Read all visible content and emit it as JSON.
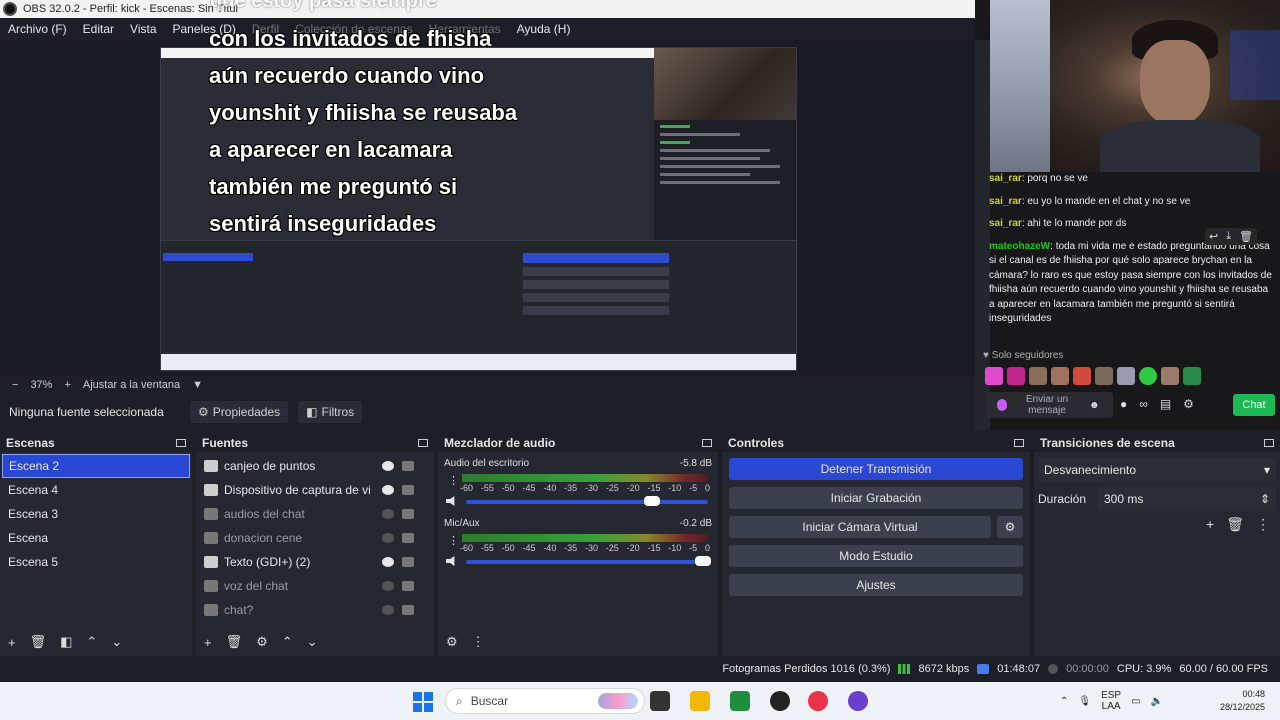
{
  "window": {
    "title": "OBS 32.0.2 - Perfil: kick - Escenas: Sin Títul",
    "overlay_caption_top": "que estoy pasa siempre"
  },
  "menu": [
    "Archivo (F)",
    "Editar",
    "Vista",
    "Paneles (D)",
    "Perfil",
    "Colección de escenas",
    "Herramientas",
    "Ayuda (H)"
  ],
  "preview": {
    "overlay_text": "con los invitados de fhisha aún recuerdo cuando vino younshit y fhiisha se reusaba a aparecer en lacamara también me preguntó si sentirá inseguridades",
    "zoom": "37%",
    "fit_label": "Ajustar a la ventana"
  },
  "sourcebar": {
    "no_source": "Ninguna fuente seleccionada",
    "properties": "Propiedades",
    "filters": "Filtros"
  },
  "chat": {
    "messages": [
      {
        "user": "sai_rar",
        "text": "porq no se ve"
      },
      {
        "user": "sai_rar",
        "text": "eu yo lo mande en el chat y no se ve"
      },
      {
        "user": "sai_rar",
        "text": "ahi te lo mande por ds"
      },
      {
        "user": "mateohazeW",
        "text": "toda mi vida me e estado preguntando una cosa si el canal es de fhiisha por qué solo aparece brychan en la cámara? lo raro es que estoy pasa siempre con los invitados de fhiisha aún recuerdo cuando vino younshit y fhiisha se reusaba a aparecer en lacamara también me preguntó si sentirá inseguridades"
      }
    ],
    "followers_only": "Solo seguidores",
    "input_placeholder": "Enviar un mensaje",
    "chat_button": "Chat"
  },
  "scenes": {
    "title": "Escenas",
    "items": [
      "Escena 2",
      "Escena 4",
      "Escena 3",
      "Escena",
      "Escena 5"
    ],
    "selected": "Escena 2"
  },
  "sources": {
    "title": "Fuentes",
    "items": [
      {
        "label": "canjeo de puntos",
        "visible": true
      },
      {
        "label": "Dispositivo de captura de vi",
        "visible": true
      },
      {
        "label": "audios del chat",
        "visible": false
      },
      {
        "label": "donacion cene",
        "visible": false
      },
      {
        "label": "Texto (GDI+) (2)",
        "visible": true
      },
      {
        "label": "voz del chat",
        "visible": false
      },
      {
        "label": "chat?",
        "visible": false
      }
    ]
  },
  "mixer": {
    "title": "Mezclador de audio",
    "channels": [
      {
        "name": "Audio del escritorio",
        "db": "-5.8 dB",
        "volume": 0.77
      },
      {
        "name": "Mic/Aux",
        "db": "-0.2 dB",
        "volume": 0.98
      }
    ],
    "scale": [
      "-60",
      "-55",
      "-50",
      "-45",
      "-40",
      "-35",
      "-30",
      "-25",
      "-20",
      "-15",
      "-10",
      "-5",
      "0"
    ]
  },
  "controls": {
    "title": "Controles",
    "buttons": [
      "Detener Transmisión",
      "Iniciar Grabación",
      "Iniciar Cámara Virtual",
      "Modo Estudio",
      "Ajustes"
    ]
  },
  "transitions": {
    "title": "Transiciones de escena",
    "selected": "Desvanecimiento",
    "duration_label": "Duración",
    "duration_value": "300 ms"
  },
  "status": {
    "dropped": "Fotogramas Perdidos 1016 (0.3%)",
    "bitrate": "8672 kbps",
    "live_time": "01:48:07",
    "rec_time": "00:00:00",
    "cpu": "CPU: 3.9%",
    "fps": "60.00 / 60.00 FPS"
  },
  "taskbar": {
    "search": "Buscar",
    "lang_top": "ESP",
    "lang_bottom": "LAA",
    "time": "00:48",
    "date": "28/12/2025"
  }
}
